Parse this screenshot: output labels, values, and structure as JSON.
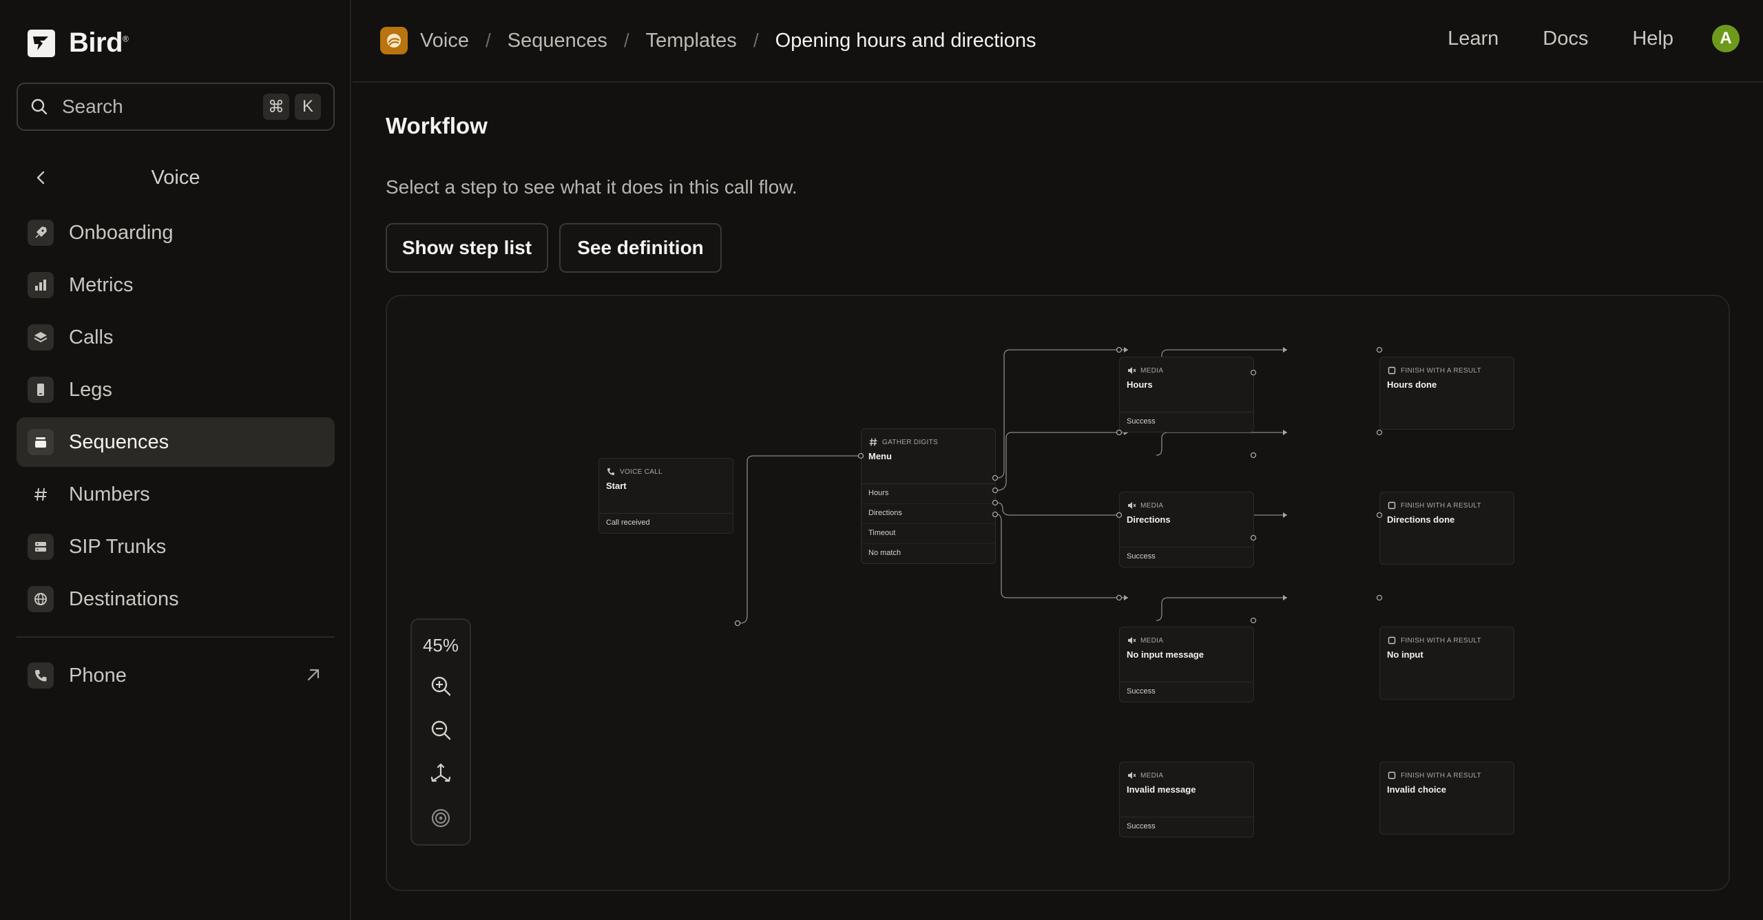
{
  "brand": {
    "name": "Bird",
    "trademark": "®"
  },
  "search": {
    "placeholder": "Search",
    "shortcut_cmd": "⌘",
    "shortcut_key": "K"
  },
  "sidebar": {
    "section_title": "Voice",
    "items": [
      {
        "label": "Onboarding",
        "icon": "rocket-icon",
        "active": false
      },
      {
        "label": "Metrics",
        "icon": "bar-chart-icon",
        "active": false
      },
      {
        "label": "Calls",
        "icon": "layers-icon",
        "active": false
      },
      {
        "label": "Legs",
        "icon": "phone-device-icon",
        "active": false
      },
      {
        "label": "Sequences",
        "icon": "stack-icon",
        "active": true
      },
      {
        "label": "Numbers",
        "icon": "hash-icon",
        "active": false
      },
      {
        "label": "SIP Trunks",
        "icon": "server-icon",
        "active": false
      },
      {
        "label": "Destinations",
        "icon": "globe-icon",
        "active": false
      }
    ],
    "phone": {
      "label": "Phone",
      "icon": "phone-icon"
    }
  },
  "header": {
    "breadcrumbs": [
      "Voice",
      "Sequences",
      "Templates",
      "Opening hours and directions"
    ],
    "links": [
      "Learn",
      "Docs",
      "Help"
    ],
    "avatar_initial": "A"
  },
  "main": {
    "title": "Workflow",
    "description": "Select a step to see what it does in this call flow.",
    "buttons": {
      "show_steps": "Show step list",
      "see_definition": "See definition"
    }
  },
  "zoom": {
    "level": "45%"
  },
  "flow": {
    "start": {
      "type": "Voice call",
      "name": "Start",
      "outputs": [
        "Call received"
      ]
    },
    "menu": {
      "type": "Gather digits",
      "name": "Menu",
      "outputs": [
        "Hours",
        "Directions",
        "Timeout",
        "No match"
      ]
    },
    "media": [
      {
        "type": "Media",
        "name": "Hours",
        "output": "Success"
      },
      {
        "type": "Media",
        "name": "Directions",
        "output": "Success"
      },
      {
        "type": "Media",
        "name": "No input message",
        "output": "Success"
      },
      {
        "type": "Media",
        "name": "Invalid message",
        "output": "Success"
      }
    ],
    "finish": [
      {
        "type": "Finish with a result",
        "name": "Hours done"
      },
      {
        "type": "Finish with a result",
        "name": "Directions done"
      },
      {
        "type": "Finish with a result",
        "name": "No input"
      },
      {
        "type": "Finish with a result",
        "name": "Invalid choice"
      }
    ]
  },
  "colors": {
    "background": "#121110",
    "accent": "#b9740f",
    "avatar": "#6e9a1c"
  }
}
